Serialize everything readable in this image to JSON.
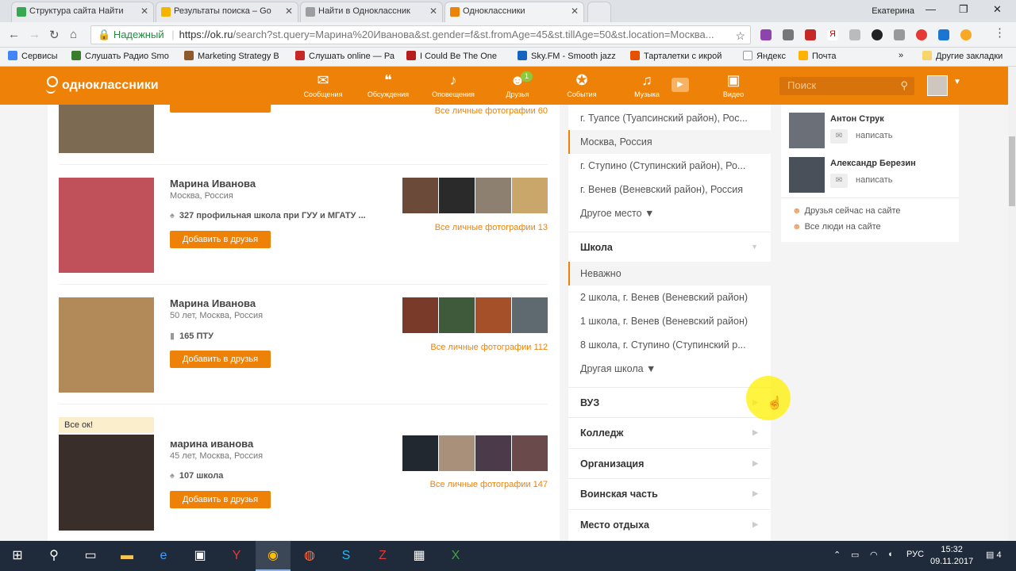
{
  "browser": {
    "tabs": [
      {
        "label": "Структура сайта Найти",
        "color": "#34a853"
      },
      {
        "label": "Результаты поиска – Go",
        "color": "#f4b400"
      },
      {
        "label": "Найти в Одноклассник",
        "color": "#9e9e9e"
      },
      {
        "label": "Одноклассники",
        "color": "#ee8208"
      }
    ],
    "user": "Екатерина",
    "url": {
      "secure_label": "Надежный",
      "host": "https://ok.ru",
      "path": "/search?st.query=Марина%20Иванова&st.gender=f&st.fromAge=45&st.tillAge=50&st.location=Москва..."
    },
    "bookmarks": [
      {
        "label": "Сервисы",
        "color": "#4285f4"
      },
      {
        "label": "Слушать Радио Smo",
        "color": "#3a7d2c"
      },
      {
        "label": "Marketing Strategy В",
        "color": "#8e5a2b"
      },
      {
        "label": "Слушать online — Ра",
        "color": "#c62828"
      },
      {
        "label": "I Could Be The One",
        "color": "#b71c1c"
      },
      {
        "label": "Sky.FM - Smooth jazz",
        "color": "#1565c0"
      },
      {
        "label": "Тарталетки с икрой",
        "color": "#e65100"
      },
      {
        "label": "Яндекс",
        "color": "#ffffff"
      },
      {
        "label": "Почта",
        "color": "#ffb300"
      }
    ],
    "bookmarks_more": "»",
    "other_bookmarks": "Другие закладки"
  },
  "ok": {
    "logo": "одноклассники",
    "nav": [
      {
        "label": "Сообщения",
        "icon": "envelope-icon",
        "glyph": "✉"
      },
      {
        "label": "Обсуждения",
        "icon": "chat-icon",
        "glyph": "💬"
      },
      {
        "label": "Оповещения",
        "icon": "bell-icon",
        "glyph": "🔔"
      },
      {
        "label": "Друзья",
        "icon": "friends-icon",
        "glyph": "👥",
        "badge": "1"
      },
      {
        "label": "События",
        "icon": "events-icon",
        "glyph": "✪"
      },
      {
        "label": "Музыка",
        "icon": "music-icon",
        "glyph": "♫"
      },
      {
        "label": "Видео",
        "icon": "video-icon",
        "glyph": "▶"
      }
    ],
    "search_placeholder": "Поиск",
    "accent": "#ee8208"
  },
  "results": {
    "top_partial": {
      "all_photos": "Все личные фотографии 60",
      "photo_color": "#7d6a53"
    },
    "people": [
      {
        "name": "Марина Иванова",
        "location": "Москва, Россия",
        "info": "327 профильная школа при ГУУ и МГАТУ ...",
        "info_icon": "pin-icon",
        "button": "Добавить в друзья",
        "all_photos": "Все личные фотографии 13",
        "photo_color": "#c0505a",
        "thumbs": [
          "#6b4a3a",
          "#2b2a2a",
          "#8e8070",
          "#c9a76a"
        ]
      },
      {
        "name": "Марина Иванова",
        "location": "50 лет, Москва, Россия",
        "info": "165 ПТУ",
        "info_icon": "book-icon",
        "button": "Добавить в друзья",
        "all_photos": "Все личные фотографии 112",
        "photo_color": "#b28a5a",
        "thumbs": [
          "#7a3a2a",
          "#3e5a3a",
          "#a6502a",
          "#5e6a70"
        ]
      },
      {
        "name": "марина иванова",
        "location": "45 лет, Москва, Россия",
        "info": "107 школа",
        "info_icon": "pin-icon",
        "button": "Добавить в друзья",
        "all_photos": "Все личные фотографии 147",
        "photo_color": "#3a2e2a",
        "thumbs": [
          "#222830",
          "#a8907a",
          "#4a3a4a",
          "#6a4a4a"
        ],
        "status_badge": "Все ок!"
      }
    ]
  },
  "filters": {
    "city_options": [
      "г. Туапсе (Туапсинский район), Рос...",
      "Москва, Россия",
      "г. Ступино (Ступинский район), Ро...",
      "г. Венев (Веневский район), Россия"
    ],
    "city_more": "Другое место ▼",
    "school_label": "Школа",
    "school_options": [
      "Неважно",
      "2 школа, г. Венев (Веневский район)",
      "1 школа, г. Венев (Веневский район)",
      "8 школа, г. Ступино (Ступинский р..."
    ],
    "school_more": "Другая школа ▼",
    "sections": [
      "ВУЗ",
      "Колледж",
      "Организация",
      "Воинская часть",
      "Место отдыха"
    ]
  },
  "sidebar": {
    "friends": [
      {
        "name": "Антон Струк",
        "action": "написать",
        "color": "#6a6f78"
      },
      {
        "name": "Александр Березин",
        "action": "написать",
        "color": "#4a505a"
      }
    ],
    "links": [
      "Друзья сейчас на сайте",
      "Все люди на сайте"
    ]
  },
  "taskbar": {
    "lang": "РУС",
    "time": "15:32",
    "date": "09.11.2017",
    "notifications": "4"
  }
}
